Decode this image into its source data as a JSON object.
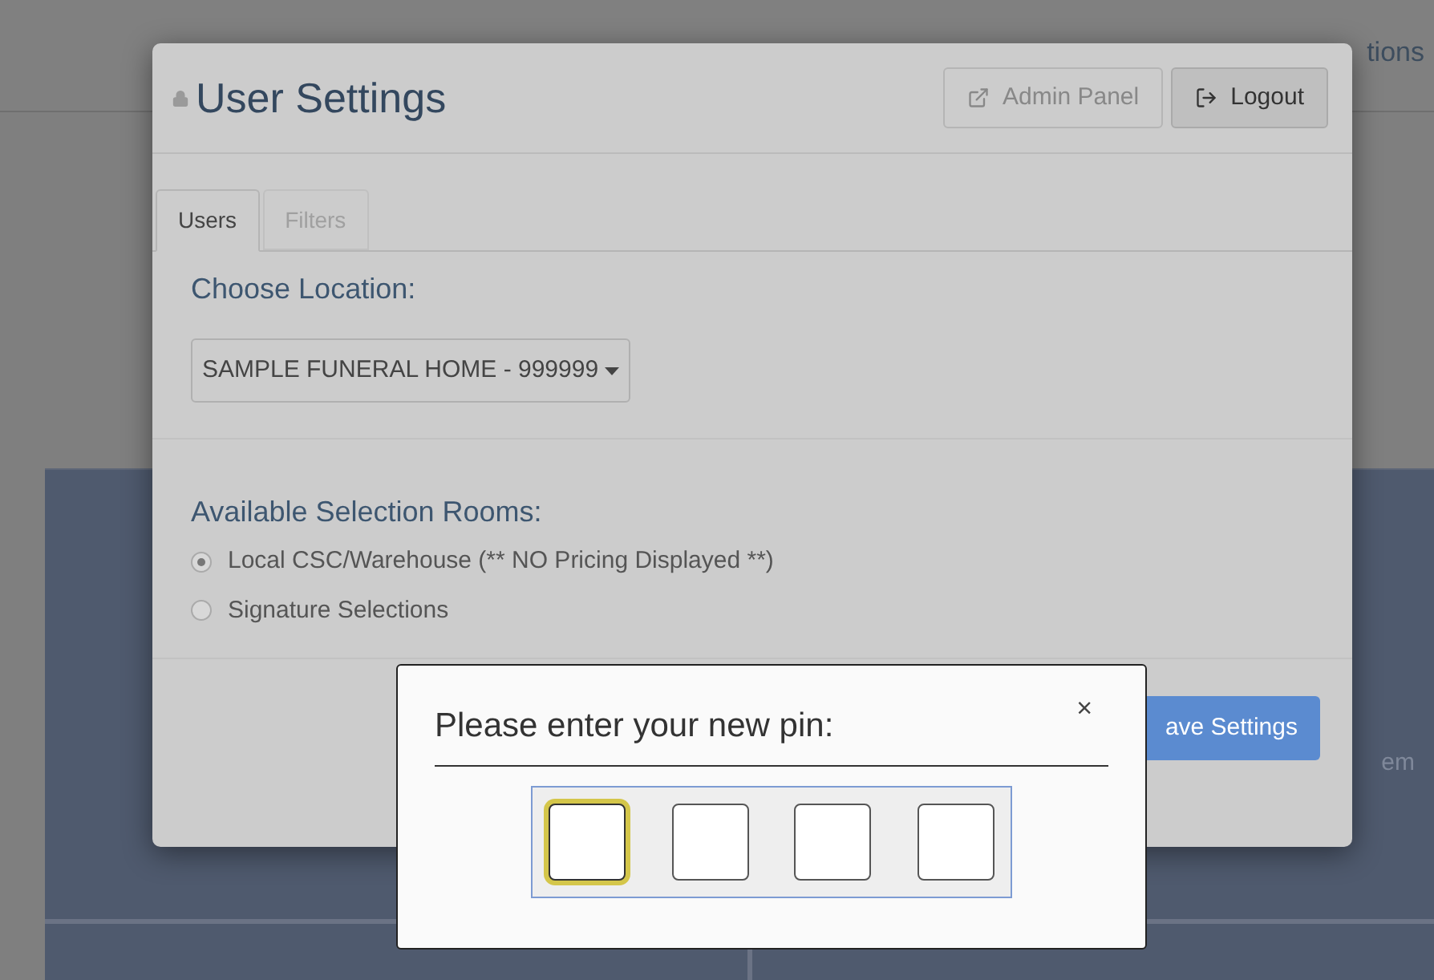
{
  "background": {
    "header_fragment": "tions",
    "side_fragment": "em"
  },
  "modal": {
    "title": "User Settings",
    "buttons": [
      {
        "label": "Admin Panel",
        "kind": "external"
      },
      {
        "label": "Logout",
        "kind": "logout"
      }
    ],
    "tabs": [
      {
        "label": "Users",
        "selected": true
      },
      {
        "label": "Filters",
        "selected": false
      }
    ],
    "location_label": "Choose Location:",
    "location_select": "SAMPLE FUNERAL HOME - 999999",
    "rooms_label": "Available Selection Rooms:",
    "rooms": [
      {
        "label": "Local CSC/Warehouse (** NO Pricing Displayed **)",
        "selected": true
      },
      {
        "label": "Signature Selections",
        "selected": false
      }
    ],
    "save_button": "ave Settings"
  },
  "pin_dialog": {
    "title": "Please enter your new pin:",
    "close": "×",
    "digits": [
      {
        "focused": true
      },
      {
        "focused": false
      },
      {
        "focused": false
      },
      {
        "focused": false
      }
    ]
  }
}
